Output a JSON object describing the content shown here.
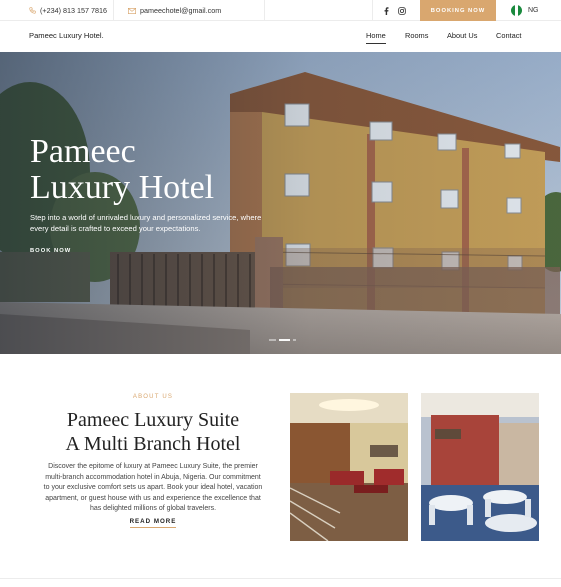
{
  "topbar": {
    "phone": "(+234) 813 157 7816",
    "email": "pameechotel@gmail.com",
    "booking_label": "BOOKING NOW",
    "language": "NG",
    "social_icons": [
      "facebook-icon",
      "instagram-icon"
    ],
    "accent_color": "#d9a76f"
  },
  "nav": {
    "brand": "Pameec Luxury Hotel.",
    "links": [
      {
        "label": "Home",
        "active": true
      },
      {
        "label": "Rooms",
        "active": false
      },
      {
        "label": "About Us",
        "active": false
      },
      {
        "label": "Contact",
        "active": false
      }
    ]
  },
  "hero": {
    "title_line1": "Pameec",
    "title_line2": "Luxury Hotel",
    "subtitle": "Step into a world of unrivaled luxury and personalized service, where every detail is crafted to exceed your expectations.",
    "button_label": "BOOK NOW",
    "slides": 3,
    "active_slide": 2
  },
  "about": {
    "label": "ABOUT US",
    "title_line1": "Pameec Luxury Suite",
    "title_line2": "A Multi Branch Hotel",
    "body": "Discover the epitome of luxury at Pameec Luxury Suite, the premier multi-branch accommodation hotel in Abuja, Nigeria. Our commitment to your exclusive comfort sets us apart. Book your ideal hotel, vacation apartment, or guest house with us and experience the excellence that has delighted millions of global travelers.",
    "read_more": "READ MORE"
  }
}
